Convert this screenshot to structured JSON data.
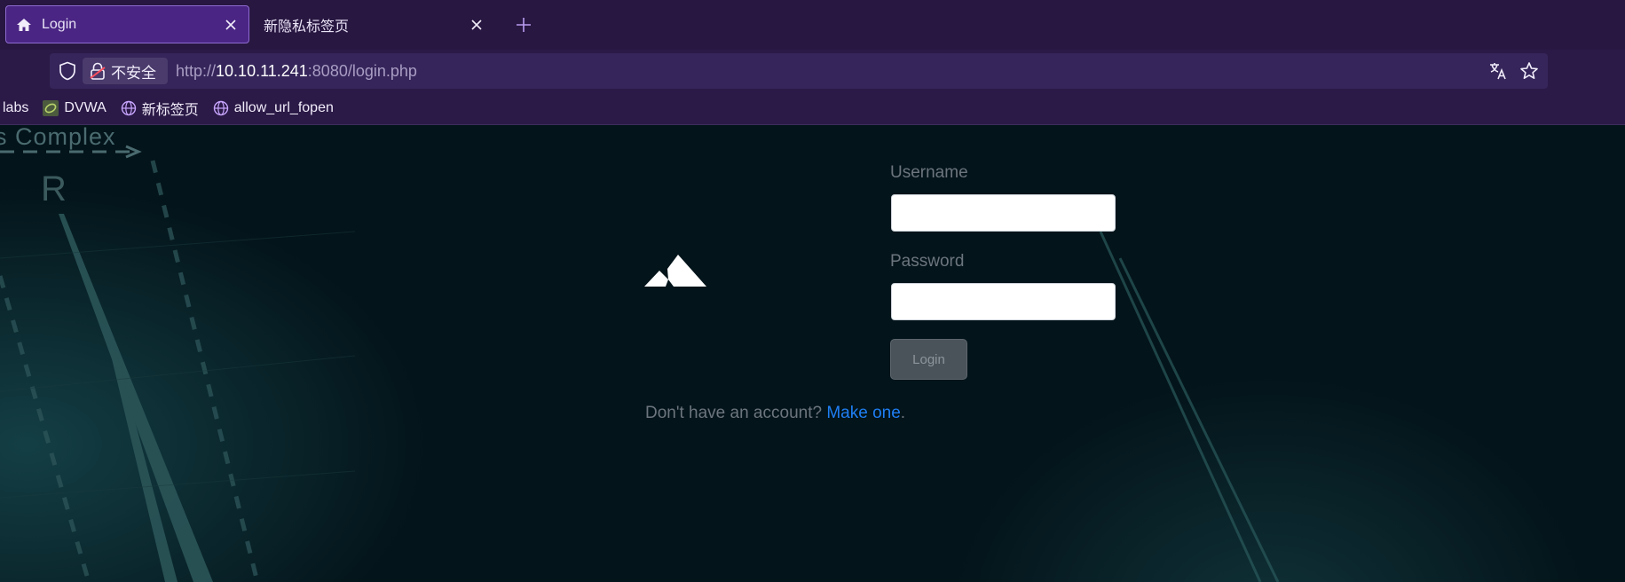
{
  "browser": {
    "tabs": [
      {
        "title": "Login",
        "icon": "home-icon",
        "active": true
      },
      {
        "title": "新隐私标签页",
        "icon": "",
        "active": false
      }
    ],
    "security_label": "不安全",
    "url": {
      "scheme": "http://",
      "host": "10.10.11.241",
      "rest": ":8080/login.php"
    },
    "bookmarks": [
      {
        "label": "labs",
        "icon": ""
      },
      {
        "label": "DVWA",
        "icon": "dvwa-icon"
      },
      {
        "label": "新标签页",
        "icon": "globe-icon"
      },
      {
        "label": "allow_url_fopen",
        "icon": "globe-icon"
      }
    ]
  },
  "background": {
    "text": "s Complex",
    "letter": "R"
  },
  "login_form": {
    "username_label": "Username",
    "username_value": "",
    "password_label": "Password",
    "password_value": "",
    "submit_label": "Login",
    "signup_prompt": "Don't have an account? ",
    "signup_link": "Make one",
    "signup_suffix": "."
  },
  "colors": {
    "link": "#1f7ef3",
    "tab_active": "#4a2584",
    "chrome": "#2b1a47"
  }
}
